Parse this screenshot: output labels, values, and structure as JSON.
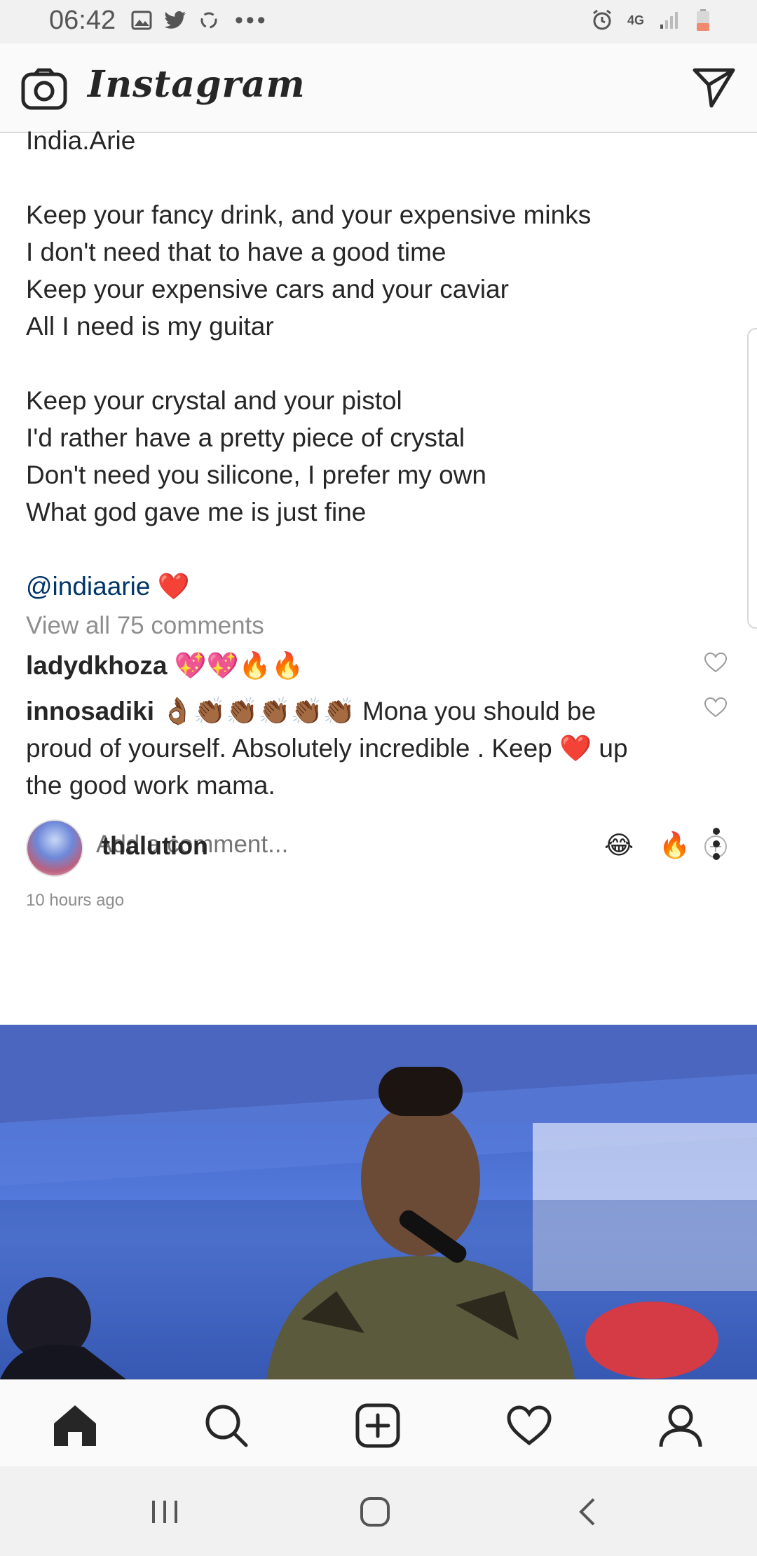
{
  "status_bar": {
    "time": "06:42",
    "network": "4G",
    "more_indicator": "•••",
    "left_icons": [
      "gallery-icon",
      "twitter-icon",
      "sync-icon"
    ],
    "right_icons": [
      "alarm-icon",
      "4g-icon",
      "signal-icon",
      "battery-low-icon"
    ]
  },
  "app_bar": {
    "wordmark": "Instagram",
    "left_icon": "camera-icon",
    "right_icon": "direct-message-icon"
  },
  "caption": {
    "lines": [
      "India.Arie",
      "",
      "Keep your fancy drink, and your expensive minks",
      "I don't need that to have a good time",
      "Keep your expensive cars and your caviar",
      "All I need is my guitar",
      "",
      "Keep your crystal and your pistol",
      "I'd rather have a pretty piece of crystal",
      "Don't need you silicone, I prefer my own",
      "What god gave me is just fine",
      ""
    ],
    "mention": "@indiaarie",
    "mention_emoji": "❤️"
  },
  "view_all_comments": "View all 75 comments",
  "comments": [
    {
      "user": "ladydkhoza",
      "text": "💖💖🔥🔥"
    },
    {
      "user": "innosadiki",
      "text_line1": "👌🏾👏🏾👏🏾👏🏾👏🏾👏🏾 Mona you should be",
      "text_line2": "proud of yourself. Absolutely incredible . Keep ❤️ up",
      "text_line3": "the good work mama."
    }
  ],
  "add_comment": {
    "placeholder": "Add a comment...",
    "quick_emojis": [
      "😂",
      "🔥"
    ]
  },
  "timestamp": "10 hours ago",
  "next_post": {
    "username": "thalution"
  },
  "colors": {
    "text": "#262626",
    "muted": "#8e8e8e",
    "mention": "#003569",
    "heart": "#ed1c24"
  }
}
